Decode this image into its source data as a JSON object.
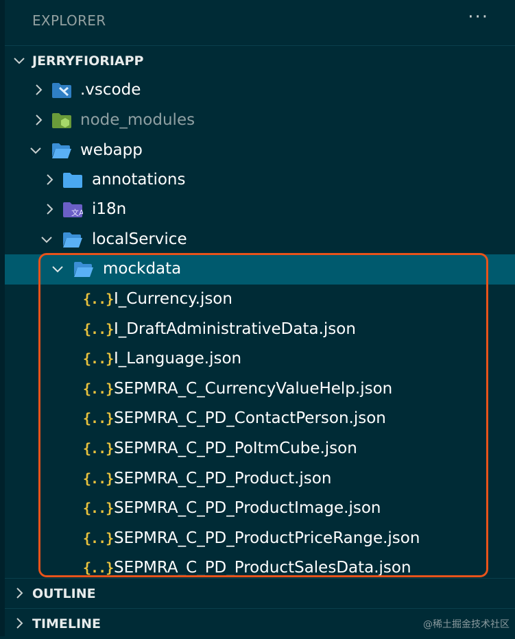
{
  "explorer": {
    "title": "EXPLORER",
    "more_label": "···"
  },
  "root": {
    "label": "JERRYFIORIAPP",
    "expanded": true
  },
  "tree": {
    "vscode": ".vscode",
    "node_modules": "node_modules",
    "webapp": "webapp",
    "annotations": "annotations",
    "i18n": "i18n",
    "localService": "localService",
    "mockdata": "mockdata",
    "files": [
      "I_Currency.json",
      "I_DraftAdministrativeData.json",
      "I_Language.json",
      "SEPMRA_C_CurrencyValueHelp.json",
      "SEPMRA_C_PD_ContactPerson.json",
      "SEPMRA_C_PD_PoItmCube.json",
      "SEPMRA_C_PD_Product.json",
      "SEPMRA_C_PD_ProductImage.json",
      "SEPMRA_C_PD_ProductPriceRange.json",
      "SEPMRA_C_PD_ProductSalesData.json"
    ],
    "json_icon_glyph": "{..}"
  },
  "sections": {
    "outline": "OUTLINE",
    "timeline": "TIMELINE"
  },
  "watermark": "@稀土掘金技术社区",
  "colors": {
    "background": "#002b36",
    "selected": "#005a6e",
    "highlight_border": "#e8531a",
    "folder_blue": "#4aa8f0",
    "json_yellow": "#e8c23e",
    "node_green": "#8bc34a"
  }
}
